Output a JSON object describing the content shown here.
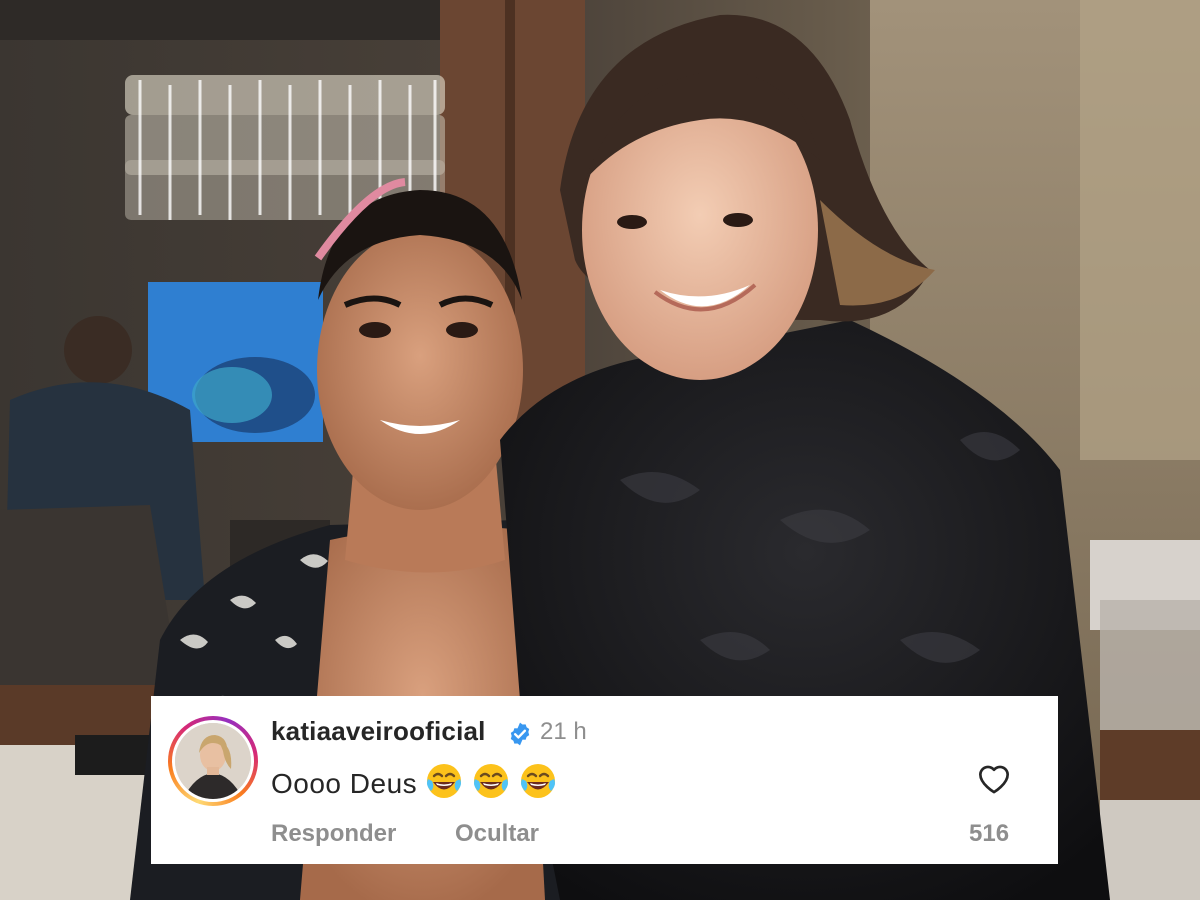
{
  "comment": {
    "username": "katiaaveirooficial",
    "verified_icon": "verified-badge-icon",
    "time": "21 h",
    "text": "Oooo Deus",
    "emojis": [
      "face-with-tears-of-joy-icon",
      "face-with-tears-of-joy-icon",
      "face-with-tears-of-joy-icon"
    ],
    "like_icon": "heart-outline-icon",
    "reply_label": "Responder",
    "hide_label": "Ocultar",
    "like_count": "516"
  },
  "colors": {
    "username": "#262626",
    "secondary_text": "#8e8e8e",
    "verified_blue": "#3897f0",
    "card_background": "#ffffff"
  }
}
